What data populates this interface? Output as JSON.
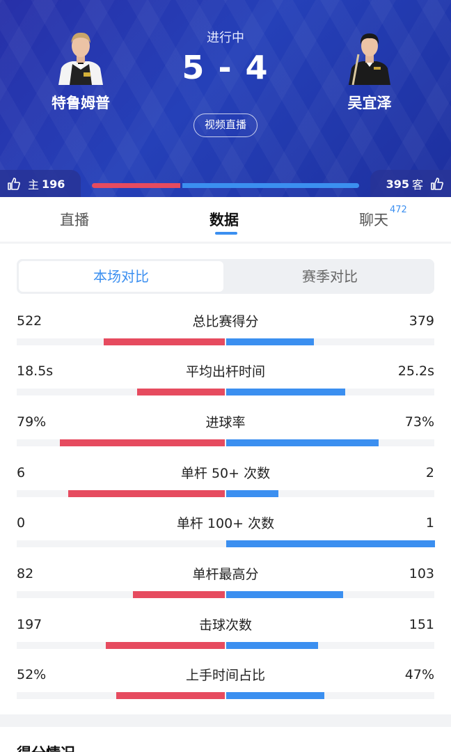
{
  "match": {
    "status": "进行中",
    "score": "5 - 4",
    "live_button": "视频直播",
    "home": {
      "name": "特鲁姆普",
      "likes_label": "主",
      "likes": "196"
    },
    "away": {
      "name": "吴宜泽",
      "likes_label": "客",
      "likes": "395"
    },
    "support_home_fraction": 0.33
  },
  "tabs": {
    "live": "直播",
    "data": "数据",
    "chat": "聊天",
    "chat_count": "472"
  },
  "segment": {
    "active": "本场对比",
    "inactive": "赛季对比"
  },
  "stats": [
    {
      "label": "总比赛得分",
      "home": "522",
      "away": "379",
      "home_frac": 0.58,
      "away_frac": 0.42
    },
    {
      "label": "平均出杆时间",
      "home": "18.5s",
      "away": "25.2s",
      "home_frac": 0.42,
      "away_frac": 0.57
    },
    {
      "label": "进球率",
      "home": "79%",
      "away": "73%",
      "home_frac": 0.79,
      "away_frac": 0.73
    },
    {
      "label": "单杆 50+ 次数",
      "home": "6",
      "away": "2",
      "home_frac": 0.75,
      "away_frac": 0.25
    },
    {
      "label": "单杆 100+ 次数",
      "home": "0",
      "away": "1",
      "home_frac": 0.0,
      "away_frac": 1.0
    },
    {
      "label": "单杆最高分",
      "home": "82",
      "away": "103",
      "home_frac": 0.44,
      "away_frac": 0.56
    },
    {
      "label": "击球次数",
      "home": "197",
      "away": "151",
      "home_frac": 0.57,
      "away_frac": 0.44
    },
    {
      "label": "上手时间占比",
      "home": "52%",
      "away": "47%",
      "home_frac": 0.52,
      "away_frac": 0.47
    }
  ],
  "bottom": {
    "title": "得分情况"
  },
  "colors": {
    "home": "#e64b5f",
    "away": "#3b8ff0",
    "header": "#2540b8"
  }
}
